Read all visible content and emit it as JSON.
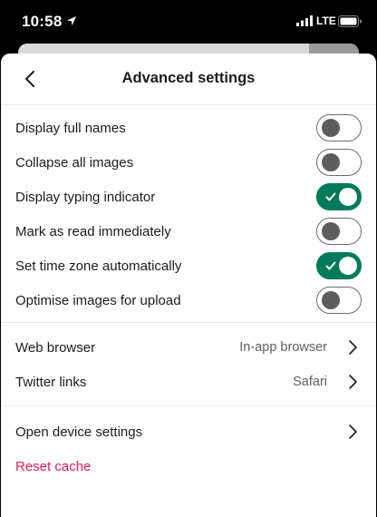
{
  "status_bar": {
    "time": "10:58",
    "network": "LTE",
    "icons": [
      "location-arrow-icon",
      "signal-icon",
      "battery-icon"
    ]
  },
  "header": {
    "title": "Advanced settings",
    "back_icon": "chevron-left-icon"
  },
  "toggles": [
    {
      "label": "Display full names",
      "on": false
    },
    {
      "label": "Collapse all images",
      "on": false
    },
    {
      "label": "Display typing indicator",
      "on": true
    },
    {
      "label": "Mark as read immediately",
      "on": false
    },
    {
      "label": "Set time zone automatically",
      "on": true
    },
    {
      "label": "Optimise images for upload",
      "on": false
    }
  ],
  "links": [
    {
      "label": "Web browser",
      "value": "In-app browser"
    },
    {
      "label": "Twitter links",
      "value": "Safari"
    }
  ],
  "device_settings": {
    "label": "Open device settings"
  },
  "reset_cache": {
    "label": "Reset cache"
  },
  "colors": {
    "toggle_on": "#007a5a",
    "destructive": "#e01e5a",
    "text": "#1d1c1d",
    "secondary_text": "#616061"
  }
}
